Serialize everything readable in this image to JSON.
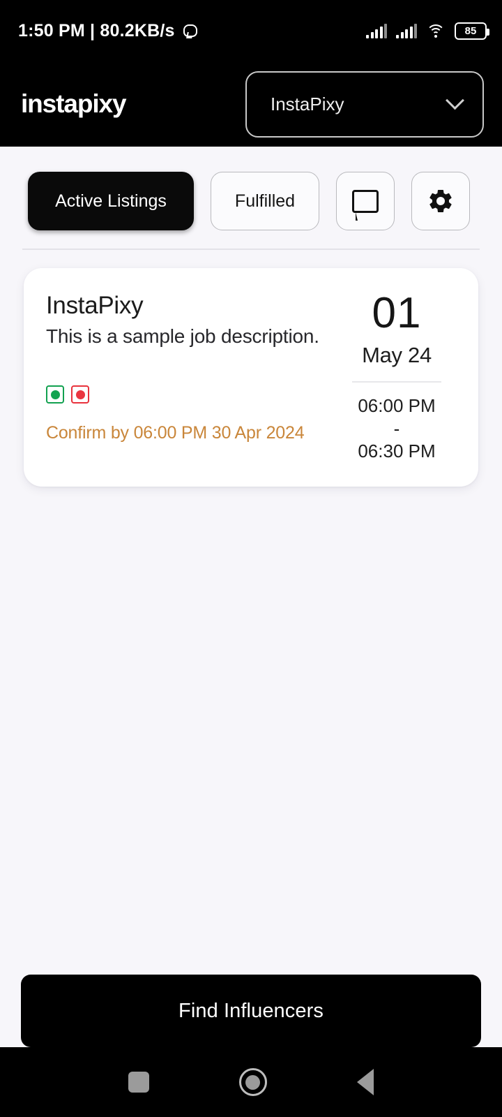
{
  "status_bar": {
    "clock": "1:50 PM | 80.2KB/s",
    "usb_icon": "android-usb-icon",
    "signal_icon": "signal-bars-icon",
    "wifi_icon": "wifi-icon",
    "battery_level": "85"
  },
  "header": {
    "logo": "instapixy",
    "brand_selector": {
      "value": "InstaPixy",
      "chevron_icon": "chevron-down-icon"
    }
  },
  "tabs": {
    "active_label": "Active Listings",
    "fulfilled_label": "Fulfilled",
    "chat_icon": "chat-bubble-icon",
    "settings_icon": "gear-icon"
  },
  "listing": {
    "title": "InstaPixy",
    "description": "This is a sample job description.",
    "status_badges": [
      {
        "name": "accepted-badge",
        "color": "#13a350"
      },
      {
        "name": "rejected-badge",
        "color": "#ea3640"
      }
    ],
    "confirm_text": "Confirm by 06:00 PM 30 Apr 2024",
    "confirm_color": "#C9863A",
    "day": "01",
    "month_year": "May 24",
    "start_time": "06:00 PM",
    "time_dash": "-",
    "end_time": "06:30 PM"
  },
  "cta": {
    "label": "Find Influencers"
  },
  "nav_bar": {
    "recents_icon": "recents-square-icon",
    "home_icon": "home-circle-icon",
    "back_icon": "back-triangle-icon"
  }
}
